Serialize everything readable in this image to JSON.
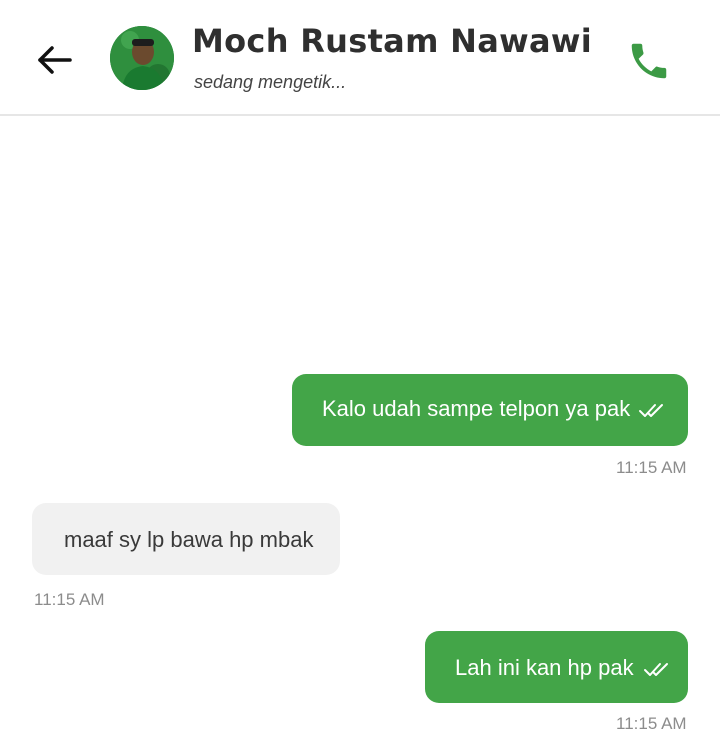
{
  "header": {
    "contact_name": "Moch Rustam Nawawi",
    "status": "sedang mengetik..."
  },
  "icons": {
    "back": "arrow-left-icon",
    "call": "phone-icon",
    "read": "double-check-icon"
  },
  "colors": {
    "accent": "#43a548",
    "incoming_bubble": "#f1f1f1",
    "timestamp": "#8c8c8c"
  },
  "messages": [
    {
      "direction": "outgoing",
      "text": "Kalo udah sampe telpon ya pak",
      "time": "11:15 AM",
      "read": true
    },
    {
      "direction": "incoming",
      "text": "maaf sy lp bawa hp mbak",
      "time": "11:15 AM"
    },
    {
      "direction": "outgoing",
      "text": "Lah ini kan hp pak",
      "time": "11:15 AM",
      "read": true
    }
  ]
}
